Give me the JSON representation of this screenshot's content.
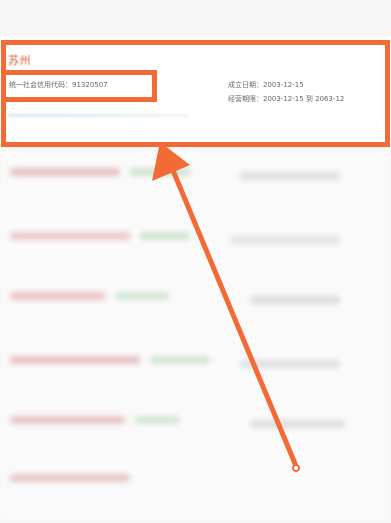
{
  "card": {
    "company_name": "苏州",
    "credit_code": "统一社会信用代码：91320507",
    "established": "成立日期：2003-12-15",
    "business_term": "经营期限：2003-12-15 到 2063-12"
  },
  "annotation": {
    "color": "#f26a36"
  }
}
